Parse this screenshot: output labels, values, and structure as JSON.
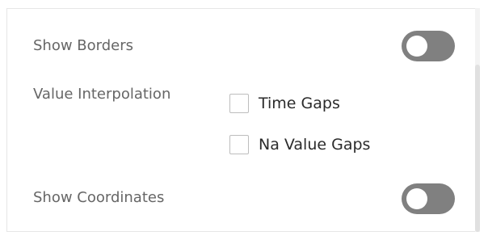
{
  "settings": {
    "show_borders": {
      "label": "Show Borders",
      "enabled": false
    },
    "value_interpolation": {
      "label": "Value Interpolation",
      "options": [
        {
          "label": "Time Gaps",
          "checked": false
        },
        {
          "label": "Na Value Gaps",
          "checked": false
        }
      ]
    },
    "show_coordinates": {
      "label": "Show Coordinates",
      "enabled": false
    }
  },
  "colors": {
    "toggle_off": "#808080",
    "label_text": "#666666",
    "option_text": "#2b2b2b"
  }
}
